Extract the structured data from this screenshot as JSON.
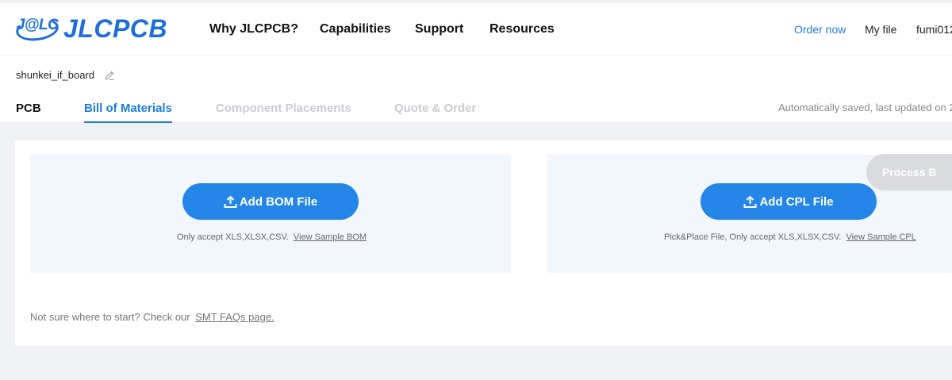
{
  "header": {
    "logo_badge": "J@LC",
    "logo_word": "JLCPCB",
    "nav": [
      "Why JLCPCB?",
      "Capabilities",
      "Support",
      "Resources"
    ],
    "order_now": "Order now",
    "my_file": "My file",
    "user": "fumi012"
  },
  "project": {
    "name": "shunkei_if_board",
    "edit_icon": "pencil-icon"
  },
  "tabs": {
    "items": [
      "PCB",
      "Bill of Materials",
      "Component Placements",
      "Quote & Order"
    ],
    "active": "Bill of Materials",
    "autosave": "Automatically saved, last updated on 2"
  },
  "bom": {
    "button": "Add BOM File",
    "hint": "Only accept XLS,XLSX,CSV.",
    "link": "View Sample BOM"
  },
  "cpl": {
    "button": "Add CPL File",
    "hint": "Pick&Place File, Only accept XLS,XLSX,CSV.",
    "link": "View Sample CPL"
  },
  "footer": {
    "text": "Not sure where to start? Check our",
    "link": "SMT FAQs page."
  },
  "process_button": "Process B",
  "colors": {
    "brand": "#1d6ed8",
    "accent": "#2487e8",
    "link": "#1c7ddf",
    "disabled": "#dadbdf",
    "panel_bg": "#f2f6fd",
    "page_bg": "#eff1f5"
  }
}
